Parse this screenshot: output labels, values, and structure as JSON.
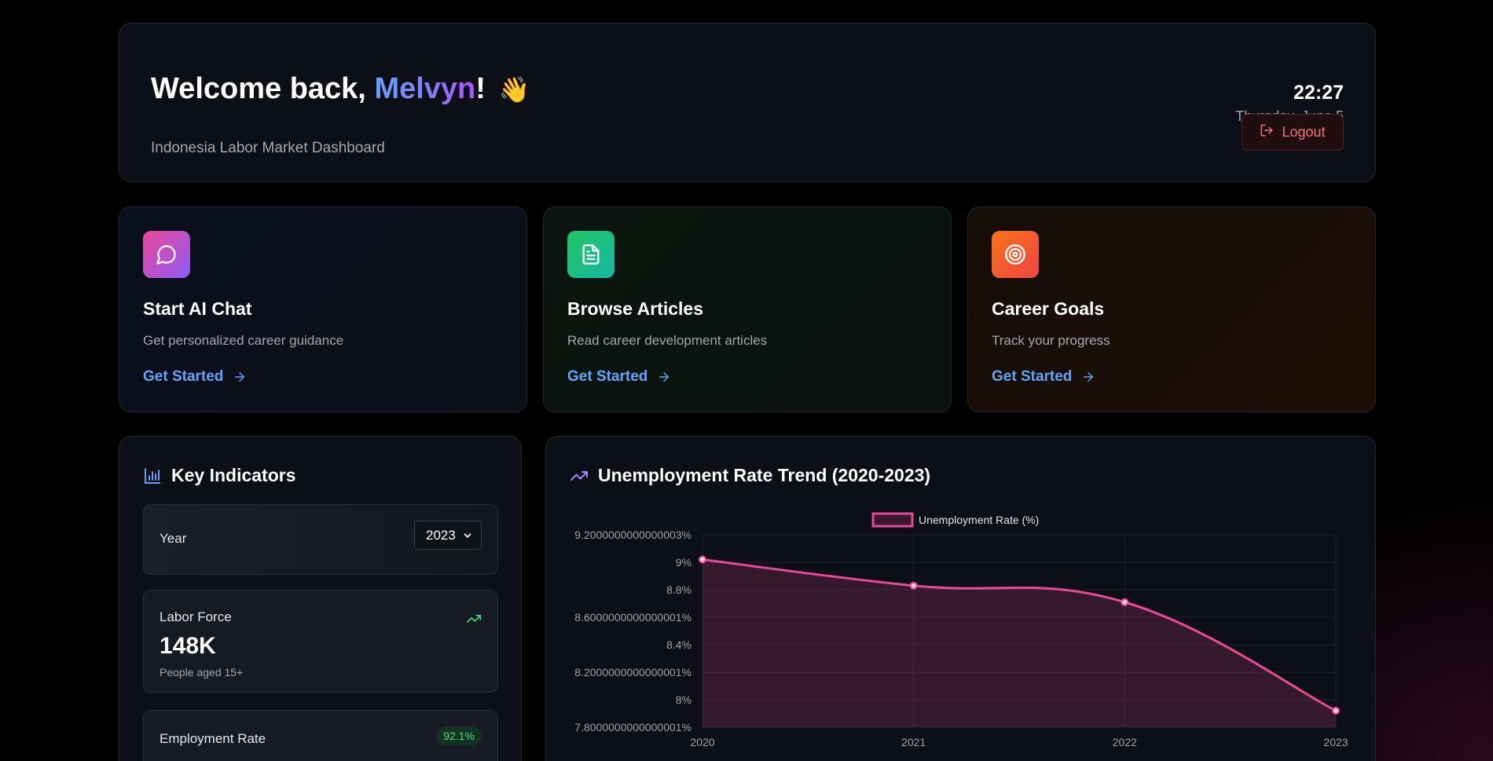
{
  "header": {
    "greeting": "Welcome back, ",
    "user_name": "Melvyn",
    "exclaim": "!",
    "wave_emoji": "👋",
    "subtitle": "Indonesia Labor Market Dashboard",
    "time": "22:27",
    "date": "Thursday, June 5",
    "logout_label": "Logout"
  },
  "features": [
    {
      "icon": "chat-bubble-icon",
      "title": "Start AI Chat",
      "description": "Get personalized career guidance",
      "link": "Get Started"
    },
    {
      "icon": "document-icon",
      "title": "Browse Articles",
      "description": "Read career development articles",
      "link": "Get Started"
    },
    {
      "icon": "target-icon",
      "title": "Career Goals",
      "description": "Track your progress",
      "link": "Get Started"
    }
  ],
  "indicators": {
    "title": "Key Indicators",
    "year_label": "Year",
    "year_value": "2023",
    "labor_force": {
      "label": "Labor Force",
      "value": "148K",
      "sub": "People aged 15+"
    },
    "employment_rate": {
      "label": "Employment Rate",
      "value": "92.1%"
    }
  },
  "trend": {
    "title": "Unemployment Rate Trend (2020-2023)"
  },
  "colors": {
    "accent_blue": "#60a5fa",
    "accent_purple": "#a855f7",
    "series_pink": "#ec4899",
    "logout_red": "#f87171",
    "positive_green": "#4ade80"
  },
  "chart_data": {
    "type": "line",
    "title": "Unemployment Rate Trend (2020-2023)",
    "x": [
      "2020",
      "2021",
      "2022",
      "2023"
    ],
    "series": [
      {
        "name": "Unemployment Rate (%)",
        "values": [
          9.02,
          8.83,
          8.71,
          7.92
        ]
      }
    ],
    "ylim": [
      7.8,
      9.2
    ],
    "yticks": [
      {
        "value": 9.2,
        "label": "9.2000000000000003%"
      },
      {
        "value": 9.0,
        "label": "9%"
      },
      {
        "value": 8.8,
        "label": "8.8%"
      },
      {
        "value": 8.6,
        "label": "8.6000000000000001%"
      },
      {
        "value": 8.4,
        "label": "8.4%"
      },
      {
        "value": 8.2,
        "label": "8.2000000000000001%"
      },
      {
        "value": 8.0,
        "label": "8%"
      },
      {
        "value": 7.8,
        "label": "7.8000000000000001%"
      }
    ],
    "legend": "top-center",
    "grid": true,
    "fill": true
  }
}
